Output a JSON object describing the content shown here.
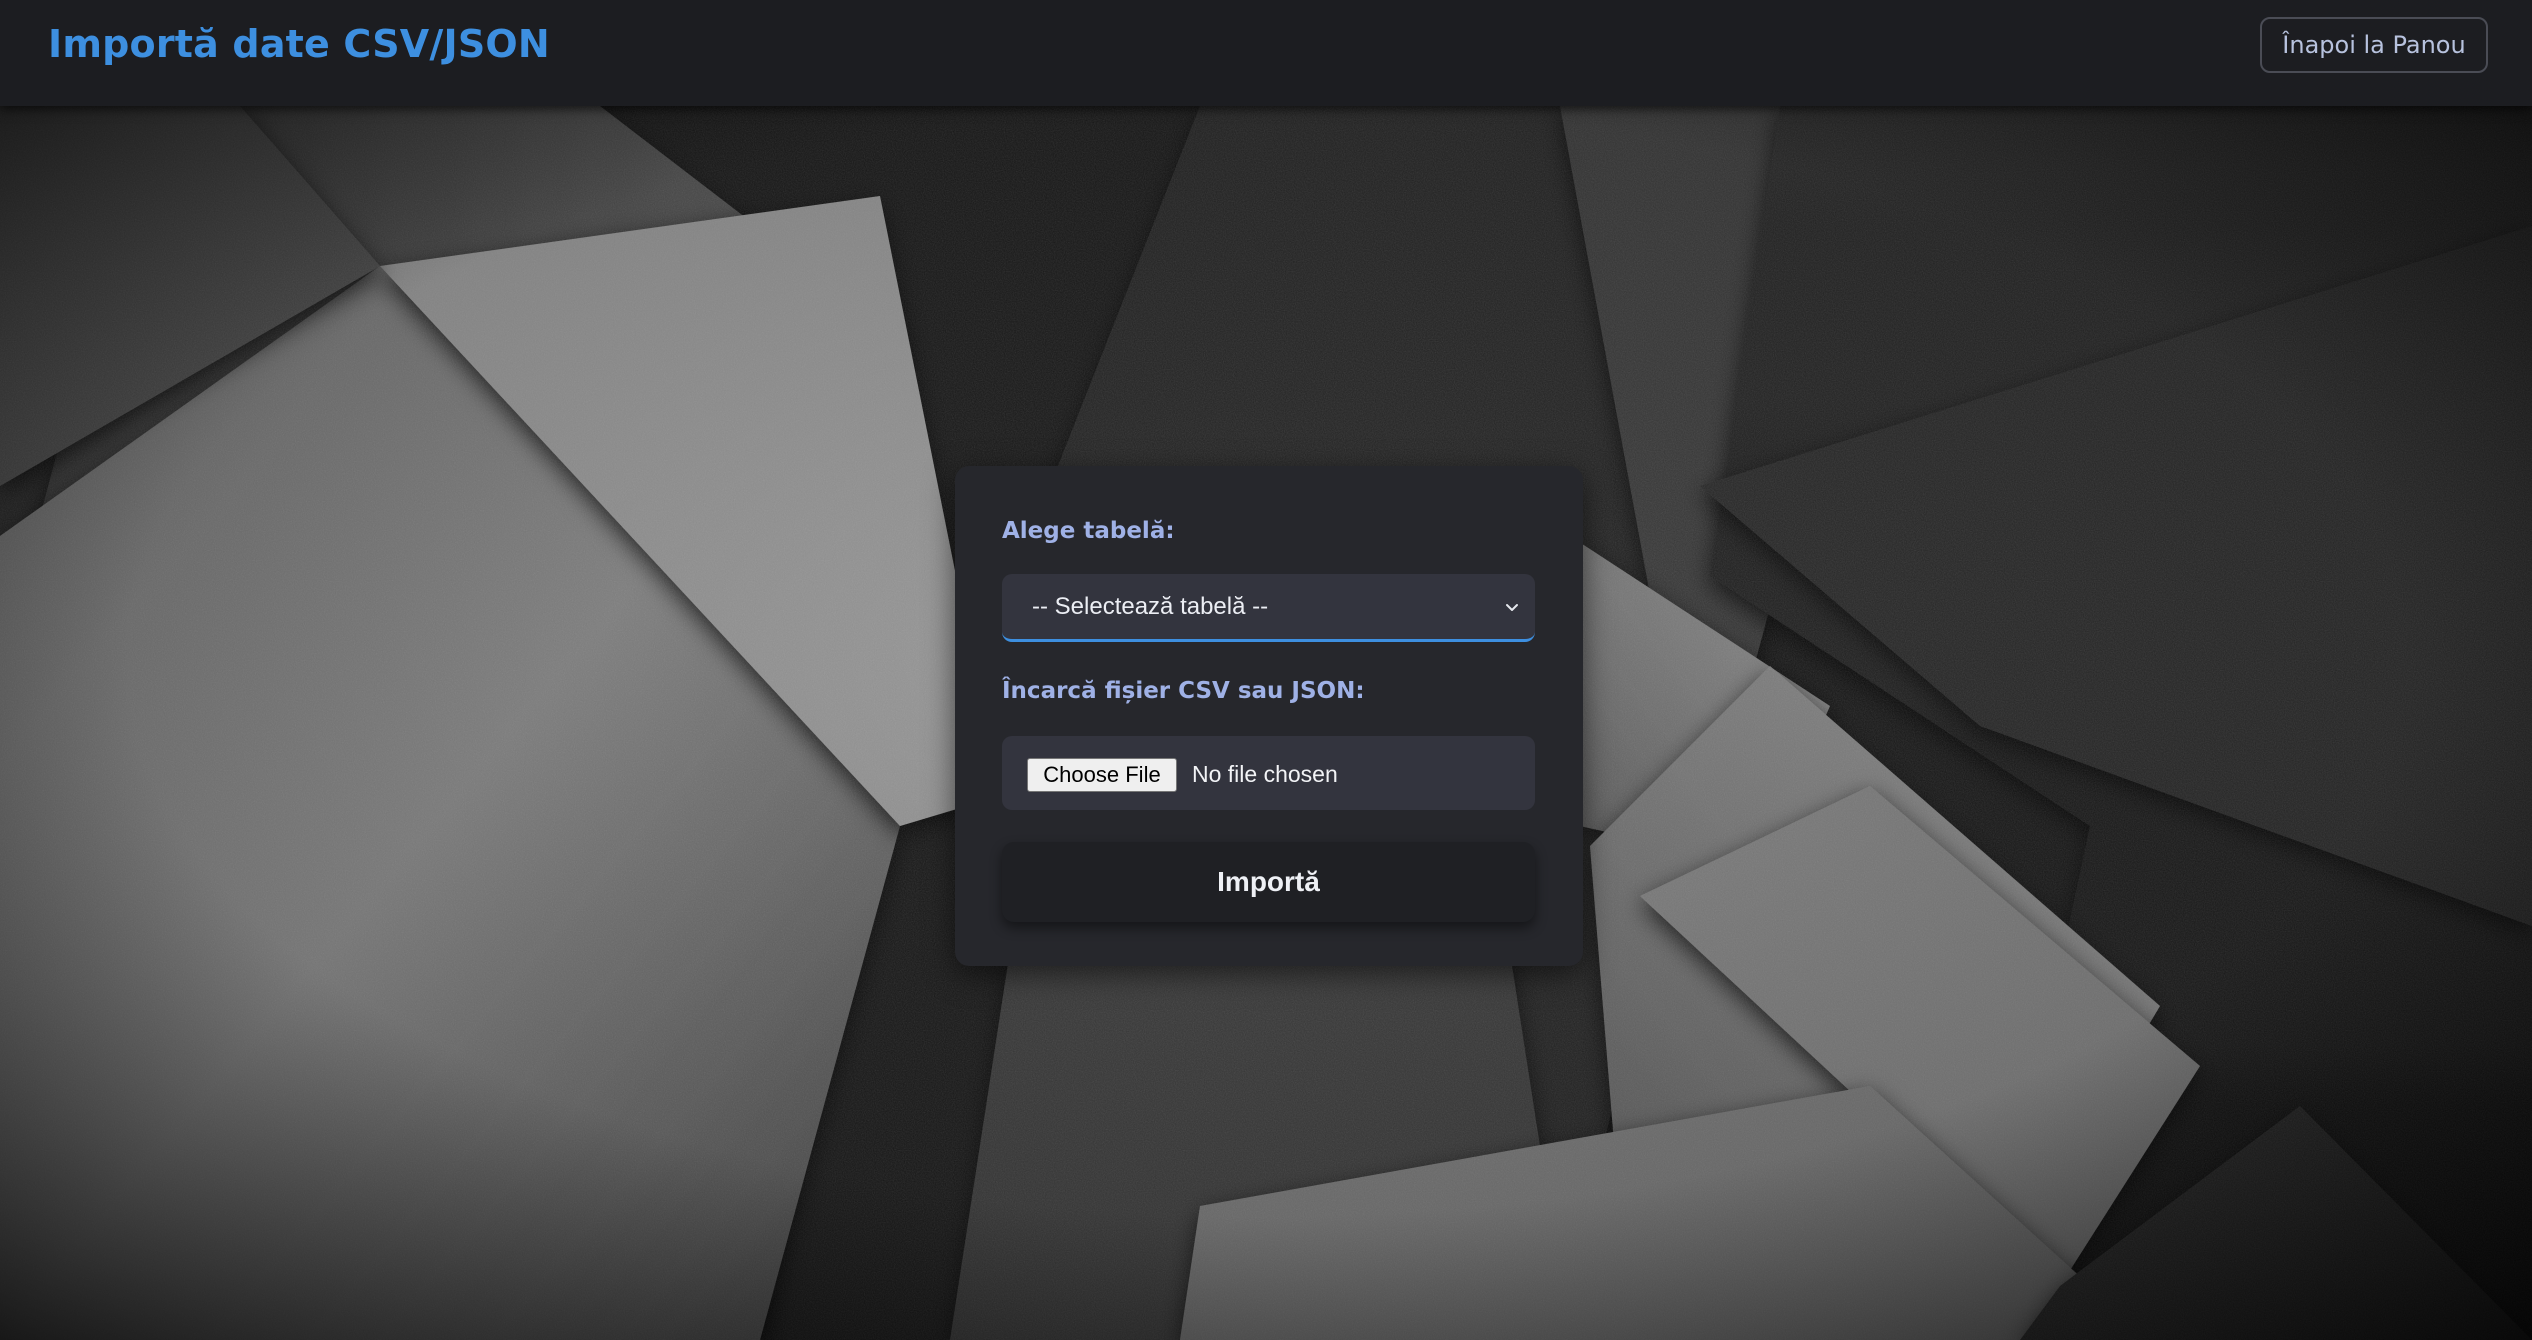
{
  "header": {
    "title": "Importă date CSV/JSON",
    "back_button_label": "Înapoi la Panou"
  },
  "form": {
    "table_label": "Alege tabelă:",
    "table_select": {
      "selected": "-- Selectează tabelă --"
    },
    "file_label": "Încarcă fișier CSV sau JSON:",
    "file_input": {
      "button_label": "Choose File",
      "status": "No file chosen"
    },
    "submit_label": "Importă"
  },
  "colors": {
    "accent": "#3d8fe0",
    "label": "#9fb1e6",
    "card": "#26272c",
    "header": "#1c1d21"
  },
  "icons": {
    "select": "chevron-down-icon"
  }
}
